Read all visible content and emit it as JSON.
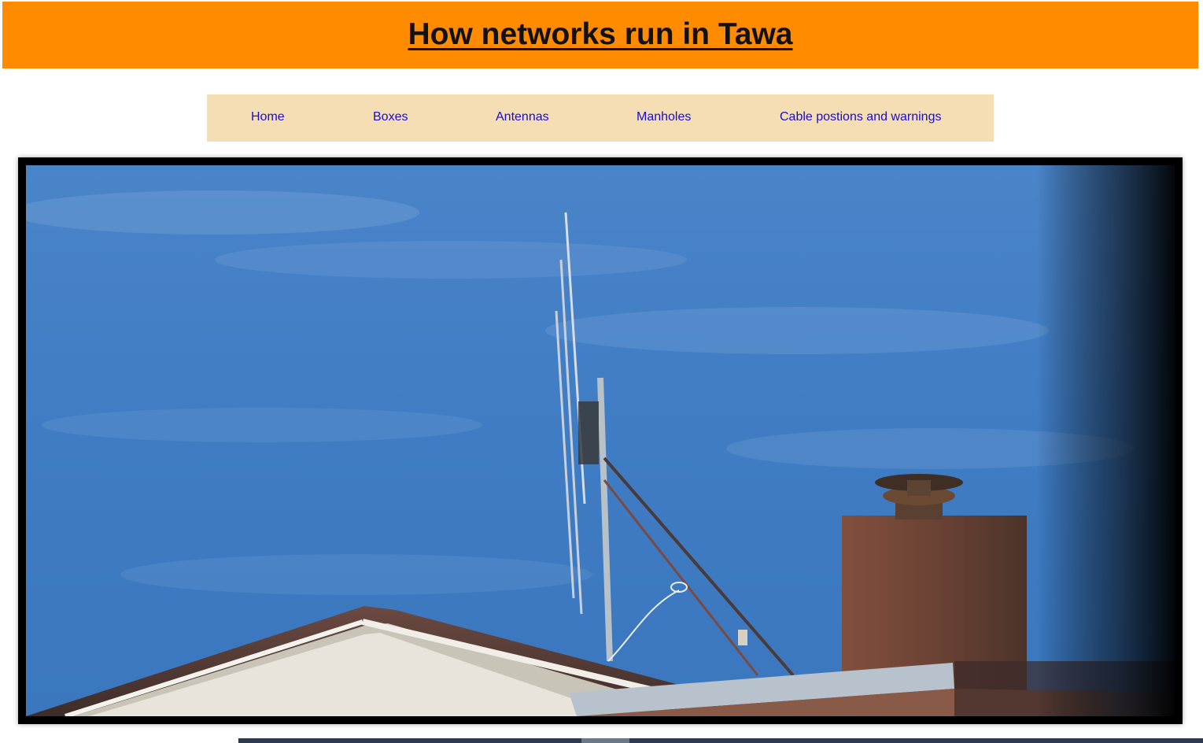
{
  "header": {
    "title": "How networks run in Tawa",
    "background_color": "#ff8c00"
  },
  "nav": {
    "background_color": "#f5deb3",
    "link_color": "#1a0dcc",
    "items": [
      {
        "label": "Home"
      },
      {
        "label": "Boxes"
      },
      {
        "label": "Antennas"
      },
      {
        "label": "Manholes"
      },
      {
        "label": "Cable postions and warnings"
      }
    ]
  },
  "main": {
    "photo": {
      "subject_icon": "antenna-on-roof-photo",
      "sky_color": "#3d7cc8"
    }
  }
}
